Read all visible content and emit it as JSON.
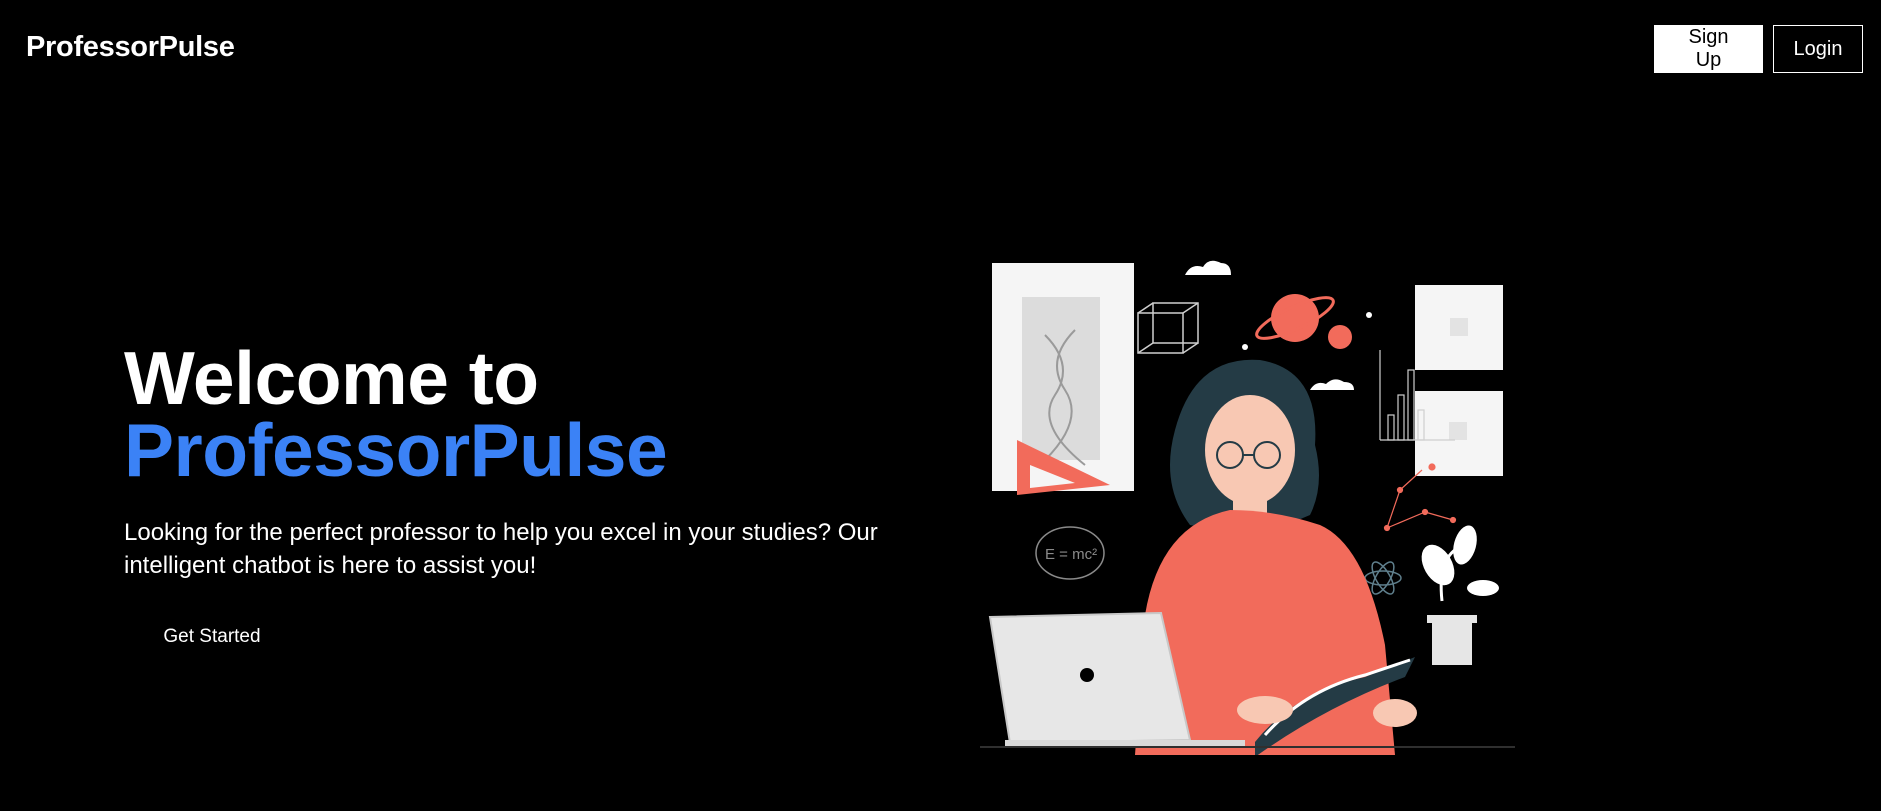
{
  "header": {
    "brand": "ProfessorPulse",
    "signup_label": "Sign Up",
    "login_label": "Login"
  },
  "hero": {
    "title_line1": "Welcome to",
    "title_line2": "ProfessorPulse",
    "description": "Looking for the perfect professor to help you excel in your studies? Our intelligent chatbot is here to assist you!",
    "cta_label": "Get Started",
    "illustration_formula": "E = mc²"
  },
  "colors": {
    "background": "#000000",
    "accent": "#3b82f6",
    "illustration_accent": "#f26b5b"
  }
}
